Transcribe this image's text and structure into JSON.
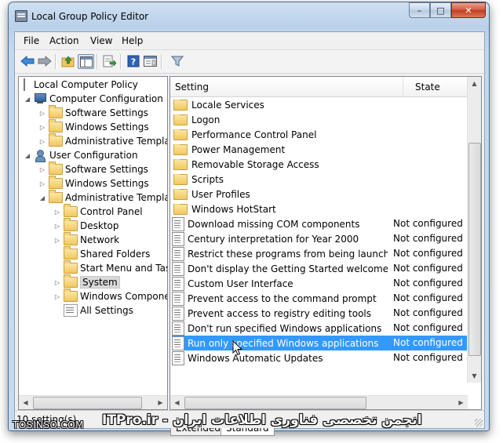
{
  "window": {
    "title": "Local Group Policy Editor"
  },
  "caption_buttons": {
    "minimize": "–",
    "maximize": "□",
    "close": "✕"
  },
  "menu": [
    "File",
    "Action",
    "View",
    "Help"
  ],
  "tree": {
    "items": [
      {
        "label": "Local Computer Policy",
        "icon": "policy-root-icon",
        "expander": ""
      },
      {
        "label": "Computer Configuration",
        "icon": "computer-icon",
        "expander": "◢"
      },
      {
        "label": "Software Settings",
        "icon": "folder-icon",
        "expander": "▷"
      },
      {
        "label": "Windows Settings",
        "icon": "folder-icon",
        "expander": "▷"
      },
      {
        "label": "Administrative Templates",
        "icon": "folder-icon",
        "expander": "▷"
      },
      {
        "label": "User Configuration",
        "icon": "user-icon",
        "expander": "◢"
      },
      {
        "label": "Software Settings",
        "icon": "folder-icon",
        "expander": "▷"
      },
      {
        "label": "Windows Settings",
        "icon": "folder-icon",
        "expander": "▷"
      },
      {
        "label": "Administrative Templates",
        "icon": "folder-icon",
        "expander": "◢"
      },
      {
        "label": "Control Panel",
        "icon": "folder-icon",
        "expander": "▷"
      },
      {
        "label": "Desktop",
        "icon": "folder-icon",
        "expander": "▷"
      },
      {
        "label": "Network",
        "icon": "folder-icon",
        "expander": "▷"
      },
      {
        "label": "Shared Folders",
        "icon": "folder-icon",
        "expander": ""
      },
      {
        "label": "Start Menu and Taskba",
        "icon": "folder-icon",
        "expander": ""
      },
      {
        "label": "System",
        "icon": "folder-icon",
        "expander": "▷",
        "selected": true
      },
      {
        "label": "Windows Components",
        "icon": "folder-icon",
        "expander": "▷"
      },
      {
        "label": "All Settings",
        "icon": "settings-icon",
        "expander": ""
      }
    ]
  },
  "list": {
    "columns": {
      "setting": "Setting",
      "state": "State"
    },
    "rows": [
      {
        "name": "Locale Services",
        "state": "",
        "type": "folder"
      },
      {
        "name": "Logon",
        "state": "",
        "type": "folder"
      },
      {
        "name": "Performance Control Panel",
        "state": "",
        "type": "folder"
      },
      {
        "name": "Power Management",
        "state": "",
        "type": "folder"
      },
      {
        "name": "Removable Storage Access",
        "state": "",
        "type": "folder"
      },
      {
        "name": "Scripts",
        "state": "",
        "type": "folder"
      },
      {
        "name": "User Profiles",
        "state": "",
        "type": "folder"
      },
      {
        "name": "Windows HotStart",
        "state": "",
        "type": "folder"
      },
      {
        "name": "Download missing COM components",
        "state": "Not configured",
        "type": "policy"
      },
      {
        "name": "Century interpretation for Year 2000",
        "state": "Not configured",
        "type": "policy"
      },
      {
        "name": "Restrict these programs from being launched ...",
        "state": "Not configured",
        "type": "policy"
      },
      {
        "name": "Don't display the Getting Started welcome scr...",
        "state": "Not configured",
        "type": "policy"
      },
      {
        "name": "Custom User Interface",
        "state": "Not configured",
        "type": "policy"
      },
      {
        "name": "Prevent access to the command prompt",
        "state": "Not configured",
        "type": "policy"
      },
      {
        "name": "Prevent access to registry editing tools",
        "state": "Not configured",
        "type": "policy"
      },
      {
        "name": "Don't run specified Windows applications",
        "state": "Not configured",
        "type": "policy"
      },
      {
        "name": "Run only specified Windows applications",
        "state": "Not configured",
        "type": "policy",
        "selected": true
      },
      {
        "name": "Windows Automatic Updates",
        "state": "Not configured",
        "type": "policy"
      }
    ]
  },
  "tabs": [
    "Extended",
    "Standard"
  ],
  "active_tab": "Standard",
  "status": {
    "text": "10 setting(s)"
  },
  "watermark": {
    "left": "TOSINSO.COM",
    "right": "انجمن تخصصی فناوری اطلاعات ایران - ITPro.ir"
  },
  "colors": {
    "selection": "#3399ff",
    "tree_selection": "#d9d9d9",
    "title_bar": "#b9d1ea"
  }
}
